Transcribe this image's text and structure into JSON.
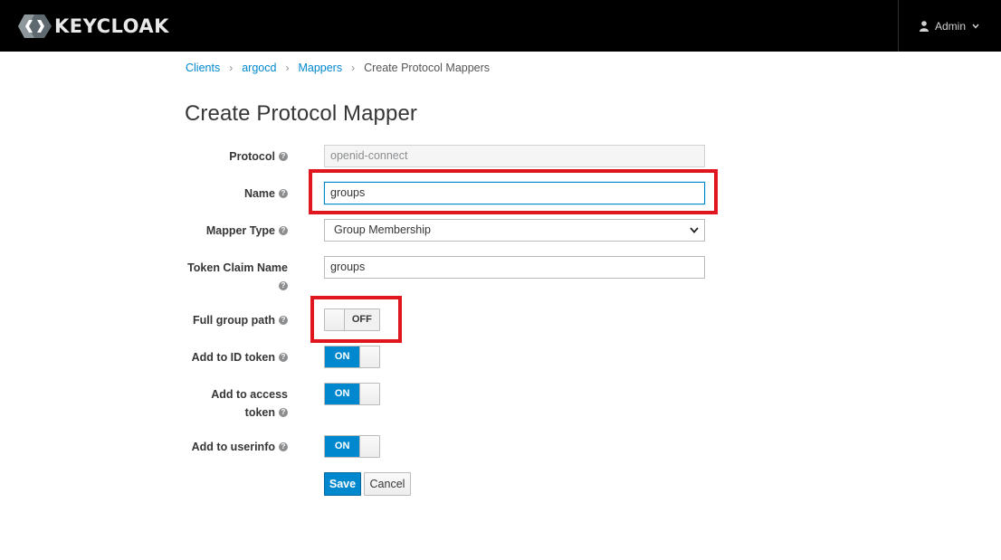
{
  "header": {
    "brand": "KEYCLOAK",
    "user_label": "Admin",
    "user_icon": "user-icon",
    "menu_icon": "chevron-down-icon"
  },
  "breadcrumb": {
    "items": [
      "Clients",
      "argocd",
      "Mappers"
    ],
    "current": "Create Protocol Mappers",
    "separator": "›"
  },
  "page": {
    "title": "Create Protocol Mapper"
  },
  "form": {
    "protocol": {
      "label": "Protocol",
      "value": "openid-connect"
    },
    "name": {
      "label": "Name",
      "value": "groups"
    },
    "mapper_type": {
      "label": "Mapper Type",
      "value": "Group Membership"
    },
    "token_claim_name": {
      "label": "Token Claim Name",
      "value": "groups"
    },
    "full_group_path": {
      "label": "Full group path",
      "state": "OFF"
    },
    "add_to_id_token": {
      "label": "Add to ID token",
      "state": "ON"
    },
    "add_to_access_token": {
      "label_line1": "Add to access",
      "label_line2": "token",
      "state": "ON"
    },
    "add_to_userinfo": {
      "label": "Add to userinfo",
      "state": "ON"
    },
    "help_glyph": "?"
  },
  "actions": {
    "save": "Save",
    "cancel": "Cancel"
  },
  "colors": {
    "accent": "#0088ce",
    "highlight": "#e0161e",
    "topbar": "#000000"
  }
}
